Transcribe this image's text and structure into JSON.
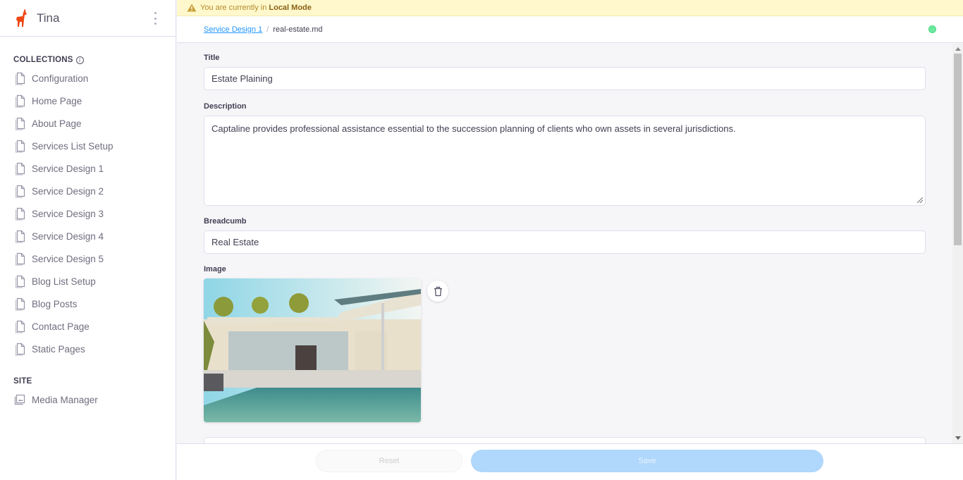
{
  "app": {
    "title": "Tina",
    "logo_icon": "llama-icon",
    "menu_icon": "kebab-icon"
  },
  "sidebar": {
    "collections_title": "COLLECTIONS",
    "collections_info_icon": "info-icon",
    "collections": [
      {
        "label": "Configuration",
        "icon": "document-icon"
      },
      {
        "label": "Home Page",
        "icon": "document-icon"
      },
      {
        "label": "About Page",
        "icon": "document-icon"
      },
      {
        "label": "Services List Setup",
        "icon": "document-icon"
      },
      {
        "label": "Service Design 1",
        "icon": "document-icon"
      },
      {
        "label": "Service Design 2",
        "icon": "document-icon"
      },
      {
        "label": "Service Design 3",
        "icon": "document-icon"
      },
      {
        "label": "Service Design 4",
        "icon": "document-icon"
      },
      {
        "label": "Service Design 5",
        "icon": "document-icon"
      },
      {
        "label": "Blog List Setup",
        "icon": "document-icon"
      },
      {
        "label": "Blog Posts",
        "icon": "document-icon"
      },
      {
        "label": "Contact Page",
        "icon": "document-icon"
      },
      {
        "label": "Static Pages",
        "icon": "document-icon"
      }
    ],
    "site_title": "SITE",
    "site": [
      {
        "label": "Media Manager",
        "icon": "image-icon"
      }
    ]
  },
  "banner": {
    "prefix": "You are currently in",
    "mode": "Local Mode",
    "icon": "warning-icon",
    "color": "#fef8cc"
  },
  "breadcrumb": {
    "parent": "Service Design 1",
    "separator": "/",
    "current": "real-estate.md"
  },
  "status": {
    "color": "#6ee7a0"
  },
  "form": {
    "title": {
      "label": "Title",
      "value": "Estate Plaining"
    },
    "description": {
      "label": "Description",
      "value": "Captaline provides professional assistance essential to the succession planning of clients who own assets in several jurisdictions."
    },
    "breadcrumb": {
      "label": "Breadcumb",
      "value": "Real Estate"
    },
    "image": {
      "label": "Image",
      "alt": "Modern house with pool",
      "delete_icon": "trash-icon"
    }
  },
  "footer": {
    "reset_label": "Reset",
    "save_label": "Save",
    "save_color": "#b0d7fc"
  }
}
